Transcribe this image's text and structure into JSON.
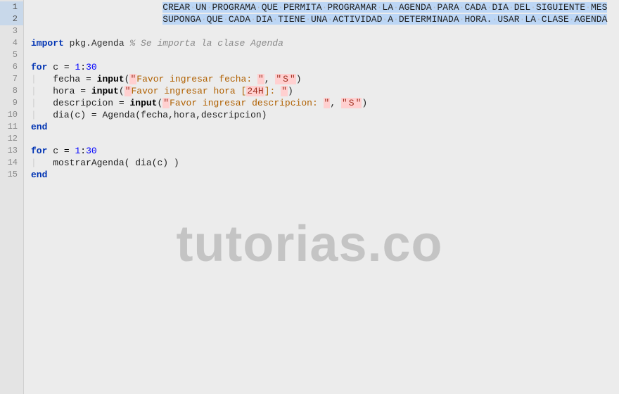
{
  "editor": {
    "selection_lines": [
      1,
      2
    ],
    "lines": [
      {
        "num": 1,
        "selected": true,
        "indent": 24,
        "segments": [
          {
            "kind": "selected_ws_text",
            "text": "CREAR UN PROGRAMA QUE PERMITA PROGRAMAR LA AGENDA PARA CADA DIA DEL SIGUIENTE MES"
          }
        ]
      },
      {
        "num": 2,
        "selected": true,
        "indent": 24,
        "segments": [
          {
            "kind": "selected_ws_text",
            "text": "SUPONGA QUE CADA DIA TIENE UNA ACTIVIDAD A DETERMINADA HORA. USAR LA CLASE AGENDA"
          }
        ]
      },
      {
        "num": 3,
        "segments": []
      },
      {
        "num": 4,
        "segments": [
          {
            "kind": "kw",
            "text": "import"
          },
          {
            "kind": "txt",
            "text": " "
          },
          {
            "kind": "pkg",
            "text": "pkg.Agenda"
          },
          {
            "kind": "txt",
            "text": " "
          },
          {
            "kind": "comment",
            "text": "% Se importa la clase Agenda"
          }
        ]
      },
      {
        "num": 5,
        "segments": []
      },
      {
        "num": 6,
        "segments": [
          {
            "kind": "kw",
            "text": "for"
          },
          {
            "kind": "txt",
            "text": " c "
          },
          {
            "kind": "op",
            "text": "="
          },
          {
            "kind": "txt",
            "text": " "
          },
          {
            "kind": "num",
            "text": "1"
          },
          {
            "kind": "op",
            "text": ":"
          },
          {
            "kind": "num",
            "text": "30"
          }
        ]
      },
      {
        "num": 7,
        "indent": 4,
        "guide": true,
        "segments": [
          {
            "kind": "txt",
            "text": "fecha "
          },
          {
            "kind": "op",
            "text": "="
          },
          {
            "kind": "txt",
            "text": " "
          },
          {
            "kind": "builtin",
            "text": "input"
          },
          {
            "kind": "txt",
            "text": "("
          },
          {
            "kind": "str-q",
            "text": "\""
          },
          {
            "kind": "str",
            "text": "Favor ingresar fecha: "
          },
          {
            "kind": "str-q",
            "text": "\""
          },
          {
            "kind": "txt",
            "text": ", "
          },
          {
            "kind": "str-q",
            "text": "\""
          },
          {
            "kind": "str-lit",
            "text": "S"
          },
          {
            "kind": "str-q",
            "text": "\""
          },
          {
            "kind": "txt",
            "text": ")"
          }
        ]
      },
      {
        "num": 8,
        "indent": 4,
        "guide": true,
        "segments": [
          {
            "kind": "txt",
            "text": "hora "
          },
          {
            "kind": "op",
            "text": "="
          },
          {
            "kind": "txt",
            "text": " "
          },
          {
            "kind": "builtin",
            "text": "input"
          },
          {
            "kind": "txt",
            "text": "("
          },
          {
            "kind": "str-q",
            "text": "\""
          },
          {
            "kind": "str",
            "text": "Favor ingresar hora ["
          },
          {
            "kind": "str-lit",
            "text": "24H"
          },
          {
            "kind": "str",
            "text": "]: "
          },
          {
            "kind": "str-q",
            "text": "\""
          },
          {
            "kind": "txt",
            "text": ")"
          }
        ]
      },
      {
        "num": 9,
        "indent": 4,
        "guide": true,
        "segments": [
          {
            "kind": "txt",
            "text": "descripcion "
          },
          {
            "kind": "op",
            "text": "="
          },
          {
            "kind": "txt",
            "text": " "
          },
          {
            "kind": "builtin",
            "text": "input"
          },
          {
            "kind": "txt",
            "text": "("
          },
          {
            "kind": "str-q",
            "text": "\""
          },
          {
            "kind": "str",
            "text": "Favor ingresar descripcion: "
          },
          {
            "kind": "str-q",
            "text": "\""
          },
          {
            "kind": "txt",
            "text": ", "
          },
          {
            "kind": "str-q",
            "text": "\""
          },
          {
            "kind": "str-lit",
            "text": "S"
          },
          {
            "kind": "str-q",
            "text": "\""
          },
          {
            "kind": "txt",
            "text": ")"
          }
        ]
      },
      {
        "num": 10,
        "indent": 4,
        "guide": true,
        "segments": [
          {
            "kind": "txt",
            "text": "dia(c) "
          },
          {
            "kind": "op",
            "text": "="
          },
          {
            "kind": "txt",
            "text": " Agenda(fecha,hora,descripcion)"
          }
        ]
      },
      {
        "num": 11,
        "segments": [
          {
            "kind": "kw",
            "text": "end"
          }
        ]
      },
      {
        "num": 12,
        "segments": []
      },
      {
        "num": 13,
        "segments": [
          {
            "kind": "kw",
            "text": "for"
          },
          {
            "kind": "txt",
            "text": " c "
          },
          {
            "kind": "op",
            "text": "="
          },
          {
            "kind": "txt",
            "text": " "
          },
          {
            "kind": "num",
            "text": "1"
          },
          {
            "kind": "op",
            "text": ":"
          },
          {
            "kind": "num",
            "text": "30"
          }
        ]
      },
      {
        "num": 14,
        "indent": 4,
        "guide": true,
        "segments": [
          {
            "kind": "txt",
            "text": "mostrarAgenda( dia(c) )"
          }
        ]
      },
      {
        "num": 15,
        "segments": [
          {
            "kind": "kw",
            "text": "end"
          }
        ]
      }
    ]
  },
  "watermark": "tutorias.co"
}
